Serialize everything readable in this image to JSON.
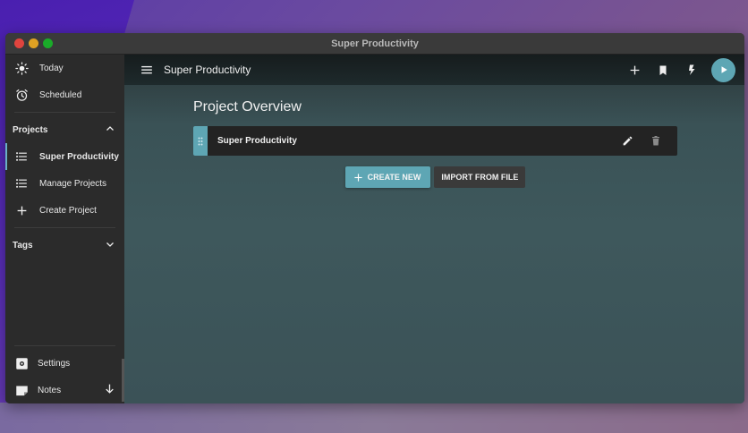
{
  "window": {
    "title": "Super Productivity"
  },
  "sidebar": {
    "top_items": [
      {
        "label": "Today",
        "icon": "sun-icon"
      },
      {
        "label": "Scheduled",
        "icon": "alarm-icon"
      }
    ],
    "projects_header": "Projects",
    "projects": [
      {
        "label": "Super Productivity",
        "icon": "list-icon",
        "active": true
      },
      {
        "label": "Manage Projects",
        "icon": "checklist-icon"
      },
      {
        "label": "Create Project",
        "icon": "plus-icon"
      }
    ],
    "tags_header": "Tags",
    "bottom_items": [
      {
        "label": "Settings",
        "icon": "gear-icon"
      },
      {
        "label": "Notes",
        "icon": "note-icon"
      }
    ]
  },
  "toolbar": {
    "title": "Super Productivity"
  },
  "main": {
    "page_title": "Project Overview",
    "project_card": {
      "name": "Super Productivity"
    },
    "create_new_label": "CREATE NEW",
    "import_label": "IMPORT FROM FILE"
  },
  "colors": {
    "accent": "#5ea6b4",
    "sidebar_bg": "#2b2b2b",
    "card_bg": "#232323"
  }
}
